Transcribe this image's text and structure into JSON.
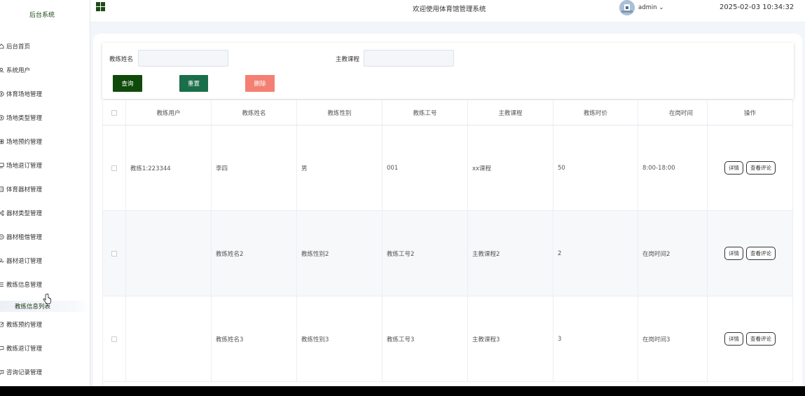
{
  "app": {
    "brand": "后台系统",
    "title": "欢迎使用体育馆管理系统"
  },
  "header": {
    "user": "admin",
    "datetime": "2025-02-03 10:34:32"
  },
  "sidebar": {
    "items": [
      {
        "label": "后台首页",
        "icon": "home-icon"
      },
      {
        "label": "系统用户",
        "icon": "user-icon"
      },
      {
        "label": "体育场地管理",
        "icon": "compass-icon"
      },
      {
        "label": "场地类型管理",
        "icon": "compass-icon"
      },
      {
        "label": "场地预约管理",
        "icon": "clover-icon"
      },
      {
        "label": "场地退订管理",
        "icon": "screen-icon"
      },
      {
        "label": "体育器材管理",
        "icon": "device-icon"
      },
      {
        "label": "器材类型管理",
        "icon": "share-icon"
      },
      {
        "label": "器材租借管理",
        "icon": "circle-minus-icon"
      },
      {
        "label": "器材退订管理",
        "icon": "users-icon"
      },
      {
        "label": "教练信息管理",
        "icon": "menu-icon"
      },
      {
        "label": "教练预约管理",
        "icon": "edit-icon"
      },
      {
        "label": "教练退订管理",
        "icon": "chat-icon"
      },
      {
        "label": "咨询记录管理",
        "icon": "message-icon"
      }
    ],
    "subitem": "教练信息列表"
  },
  "search": {
    "name_label": "教练姓名",
    "name_value": "",
    "course_label": "主教课程",
    "course_value": "",
    "query_button": "查询",
    "reset_button": "重置",
    "delete_button": "删除"
  },
  "table": {
    "headers": [
      "教练用户",
      "教练姓名",
      "教练性别",
      "教练工号",
      "主教课程",
      "教练时价",
      "在岗时间",
      "操作"
    ],
    "rows": [
      [
        "教练1:223344",
        "李四",
        "男",
        "001",
        "xx课程",
        "50",
        "8:00-18:00"
      ],
      [
        "",
        "教练姓名2",
        "教练性别2",
        "教练工号2",
        "主教课程2",
        "2",
        "在岗时间2"
      ],
      [
        "",
        "教练姓名3",
        "教练性别3",
        "教练工号3",
        "主教课程3",
        "3",
        "在岗时间3"
      ]
    ],
    "detail_button": "详情",
    "review_button": "查看评论"
  }
}
